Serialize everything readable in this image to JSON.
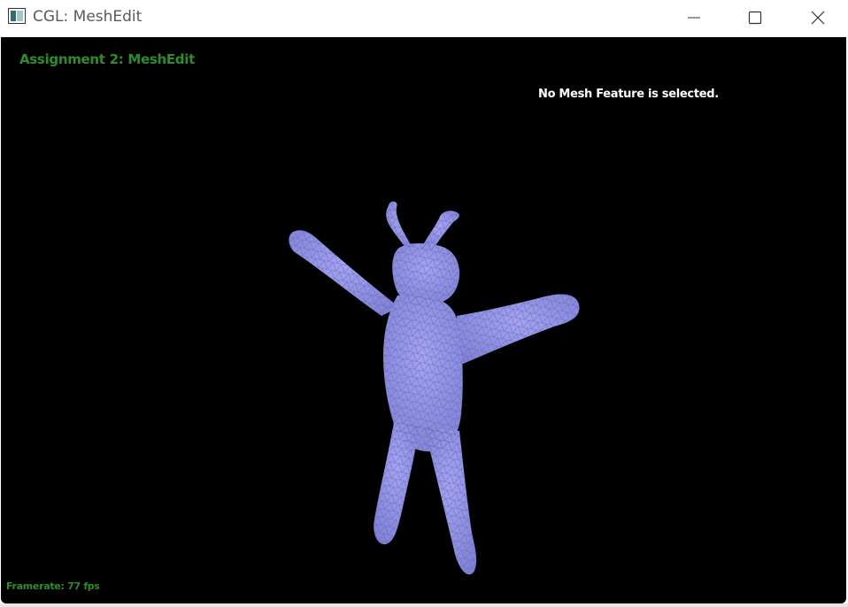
{
  "window": {
    "title": "CGL: MeshEdit",
    "controls": {
      "minimize": "minimize-icon",
      "maximize": "maximize-icon",
      "close": "close-icon"
    }
  },
  "viewport": {
    "overlay_title": "Assignment 2: MeshEdit",
    "selection_status": "No Mesh Feature is selected.",
    "framerate": "Framerate: 77 fps",
    "mesh": {
      "fill_color": "#9090e8",
      "wire_color": "#6a6ab8",
      "background": "#000000"
    }
  },
  "colors": {
    "overlay_green": "#2e8b2e",
    "status_text": "#ffffff"
  }
}
